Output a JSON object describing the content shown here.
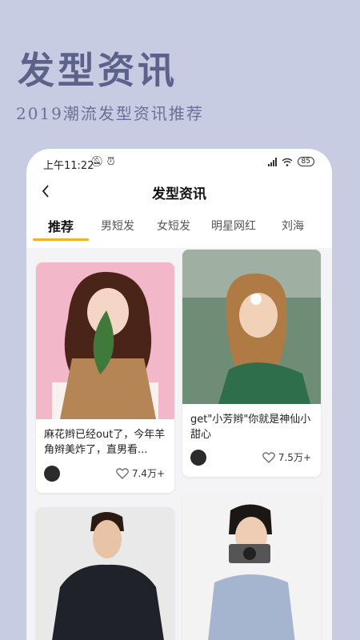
{
  "promo": {
    "title": "发型资讯",
    "subtitle": "2019潮流发型资讯推荐"
  },
  "status_bar": {
    "time": "上午11:22",
    "battery": "85",
    "icons": [
      "mute-icon",
      "alarm-icon",
      "signal-icon",
      "wifi-icon",
      "battery-icon"
    ]
  },
  "nav": {
    "back_icon": "chevron-left-icon",
    "title": "发型资讯"
  },
  "tabs": [
    {
      "label": "推荐",
      "active": true
    },
    {
      "label": "男短发",
      "active": false
    },
    {
      "label": "女短发",
      "active": false
    },
    {
      "label": "明星网红",
      "active": false
    },
    {
      "label": "刘海",
      "active": false
    }
  ],
  "colors": {
    "background": "#c7cce3",
    "promo_text": "#5c6289",
    "tab_indicator": "#f0b429"
  },
  "cards": [
    {
      "title": "麻花辫已经out了，今年羊角辫美炸了，直男看...",
      "likes": "7.4万+"
    },
    {
      "title": "get\"小芳辫\"你就是神仙小甜心",
      "likes": "7.5万+"
    },
    {
      "title": "",
      "likes": ""
    },
    {
      "title": "",
      "likes": ""
    }
  ]
}
